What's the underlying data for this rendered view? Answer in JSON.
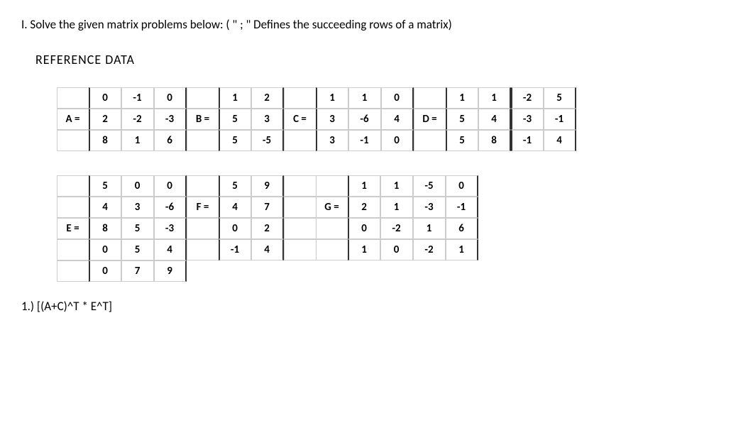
{
  "instruction": "I. Solve the given matrix problems below: ( \" ; \" Defines the succeeding rows of a matrix)",
  "heading": "REFERENCE DATA",
  "matrices": {
    "A": {
      "label": "A =",
      "rows": [
        [
          0,
          -1,
          0
        ],
        [
          2,
          -2,
          -3
        ],
        [
          8,
          1,
          6
        ]
      ]
    },
    "B": {
      "label": "B =",
      "rows": [
        [
          1,
          2
        ],
        [
          5,
          3
        ],
        [
          5,
          -5
        ]
      ]
    },
    "C": {
      "label": "C =",
      "rows": [
        [
          1,
          1,
          0
        ],
        [
          3,
          -6,
          4
        ],
        [
          3,
          -1,
          0
        ]
      ]
    },
    "D": {
      "label": "D =",
      "rows": [
        [
          1,
          1
        ],
        [
          5,
          4
        ],
        [
          5,
          8
        ]
      ]
    },
    "X": {
      "label": "",
      "rows": [
        [
          -2,
          5
        ],
        [
          -3,
          -1
        ],
        [
          -1,
          4
        ]
      ]
    },
    "E": {
      "label": "E =",
      "rows": [
        [
          5,
          0,
          0
        ],
        [
          4,
          3,
          -6
        ],
        [
          8,
          5,
          -3
        ],
        [
          0,
          5,
          4
        ],
        [
          0,
          7,
          9
        ]
      ]
    },
    "F": {
      "label": "F =",
      "rows": [
        [
          5,
          9
        ],
        [
          4,
          7
        ],
        [
          0,
          2
        ],
        [
          -1,
          4
        ]
      ]
    },
    "G": {
      "label": "G =",
      "rows": [
        [
          1,
          1,
          -5,
          0
        ],
        [
          2,
          1,
          -3,
          -1
        ],
        [
          0,
          -2,
          1,
          6
        ],
        [
          1,
          0,
          -2,
          1
        ]
      ]
    }
  },
  "question": "1.) [(A+C)^T * E^T]"
}
